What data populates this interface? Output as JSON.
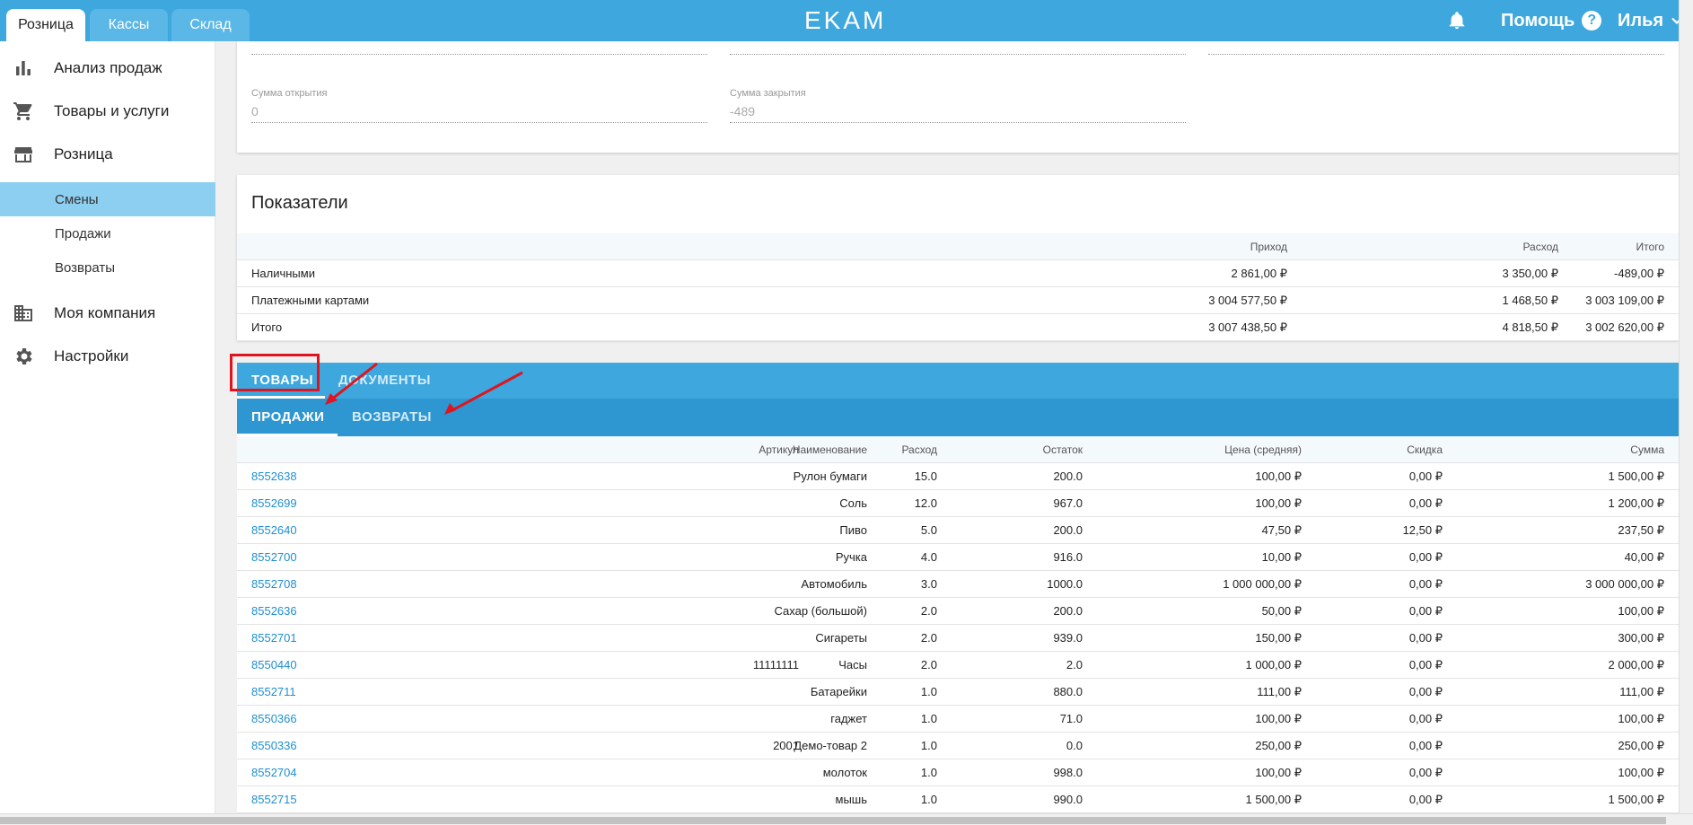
{
  "top_tabs": [
    {
      "label": "Розница",
      "active": true
    },
    {
      "label": "Кассы",
      "active": false
    },
    {
      "label": "Склад",
      "active": false
    }
  ],
  "logo": "EKAM",
  "header": {
    "help_label": "Помощь",
    "user_name": "Илья"
  },
  "sidebar": {
    "items": [
      {
        "label": "Анализ продаж",
        "icon": "bar-chart-icon"
      },
      {
        "label": "Товары и услуги",
        "icon": "cart-icon"
      },
      {
        "label": "Розница",
        "icon": "store-icon"
      }
    ],
    "sub_items": [
      {
        "label": "Смены",
        "active": true
      },
      {
        "label": "Продажи",
        "active": false
      },
      {
        "label": "Возвраты",
        "active": false
      }
    ],
    "bottom_items": [
      {
        "label": "Моя компания",
        "icon": "building-icon"
      },
      {
        "label": "Настройки",
        "icon": "gear-icon"
      }
    ]
  },
  "shift_fields": {
    "open_sum_label": "Сумма открытия",
    "open_sum_value": "0",
    "close_sum_label": "Сумма закрытия",
    "close_sum_value": "-489"
  },
  "indicators": {
    "title": "Показатели",
    "columns": [
      "",
      "Приход",
      "Расход",
      "Итого"
    ],
    "rows": [
      [
        "Наличными",
        "2 861,00 ₽",
        "3 350,00 ₽",
        "-489,00 ₽"
      ],
      [
        "Платежными картами",
        "3 004 577,50 ₽",
        "1 468,50 ₽",
        "3 003 109,00 ₽"
      ],
      [
        "Итого",
        "3 007 438,50 ₽",
        "4 818,50 ₽",
        "3 002 620,00 ₽"
      ]
    ]
  },
  "main_tabs": [
    {
      "label": "ТОВАРЫ",
      "active": true
    },
    {
      "label": "ДОКУМЕНТЫ",
      "active": false
    }
  ],
  "sub_tabs": [
    {
      "label": "ПРОДАЖИ",
      "active": true
    },
    {
      "label": "ВОЗВРАТЫ",
      "active": false
    }
  ],
  "goods_table": {
    "columns": [
      "",
      "Наименование",
      "Артикул",
      "Расход",
      "Остаток",
      "Цена (средняя)",
      "Скидка",
      "Сумма"
    ],
    "rows": [
      [
        "8552638",
        "Рулон бумаги",
        "",
        "15.0",
        "200.0",
        "100,00 ₽",
        "0,00 ₽",
        "1 500,00 ₽"
      ],
      [
        "8552699",
        "Соль",
        "",
        "12.0",
        "967.0",
        "100,00 ₽",
        "0,00 ₽",
        "1 200,00 ₽"
      ],
      [
        "8552640",
        "Пиво",
        "",
        "5.0",
        "200.0",
        "47,50 ₽",
        "12,50 ₽",
        "237,50 ₽"
      ],
      [
        "8552700",
        "Ручка",
        "",
        "4.0",
        "916.0",
        "10,00 ₽",
        "0,00 ₽",
        "40,00 ₽"
      ],
      [
        "8552708",
        "Автомобиль",
        "",
        "3.0",
        "1000.0",
        "1 000 000,00 ₽",
        "0,00 ₽",
        "3 000 000,00 ₽"
      ],
      [
        "8552636",
        "Сахар (большой)",
        "",
        "2.0",
        "200.0",
        "50,00 ₽",
        "0,00 ₽",
        "100,00 ₽"
      ],
      [
        "8552701",
        "Сигареты",
        "",
        "2.0",
        "939.0",
        "150,00 ₽",
        "0,00 ₽",
        "300,00 ₽"
      ],
      [
        "8550440",
        "Часы",
        "11111111",
        "2.0",
        "2.0",
        "1 000,00 ₽",
        "0,00 ₽",
        "2 000,00 ₽"
      ],
      [
        "8552711",
        "Батарейки",
        "",
        "1.0",
        "880.0",
        "111,00 ₽",
        "0,00 ₽",
        "111,00 ₽"
      ],
      [
        "8550366",
        "гаджет",
        "",
        "1.0",
        "71.0",
        "100,00 ₽",
        "0,00 ₽",
        "100,00 ₽"
      ],
      [
        "8550336",
        "Демо-товар 2",
        "2001",
        "1.0",
        "0.0",
        "250,00 ₽",
        "0,00 ₽",
        "250,00 ₽"
      ],
      [
        "8552704",
        "молоток",
        "",
        "1.0",
        "998.0",
        "100,00 ₽",
        "0,00 ₽",
        "100,00 ₽"
      ],
      [
        "8552715",
        "мышь",
        "",
        "1.0",
        "990.0",
        "1 500,00 ₽",
        "0,00 ₽",
        "1 500,00 ₽"
      ]
    ]
  },
  "colors": {
    "header_blue": "#3ea7dd",
    "subtab_blue": "#2e96d1",
    "sidebar_active": "#8dcff0",
    "link": "#1f8fcf",
    "annotation_red": "#e0141e"
  }
}
